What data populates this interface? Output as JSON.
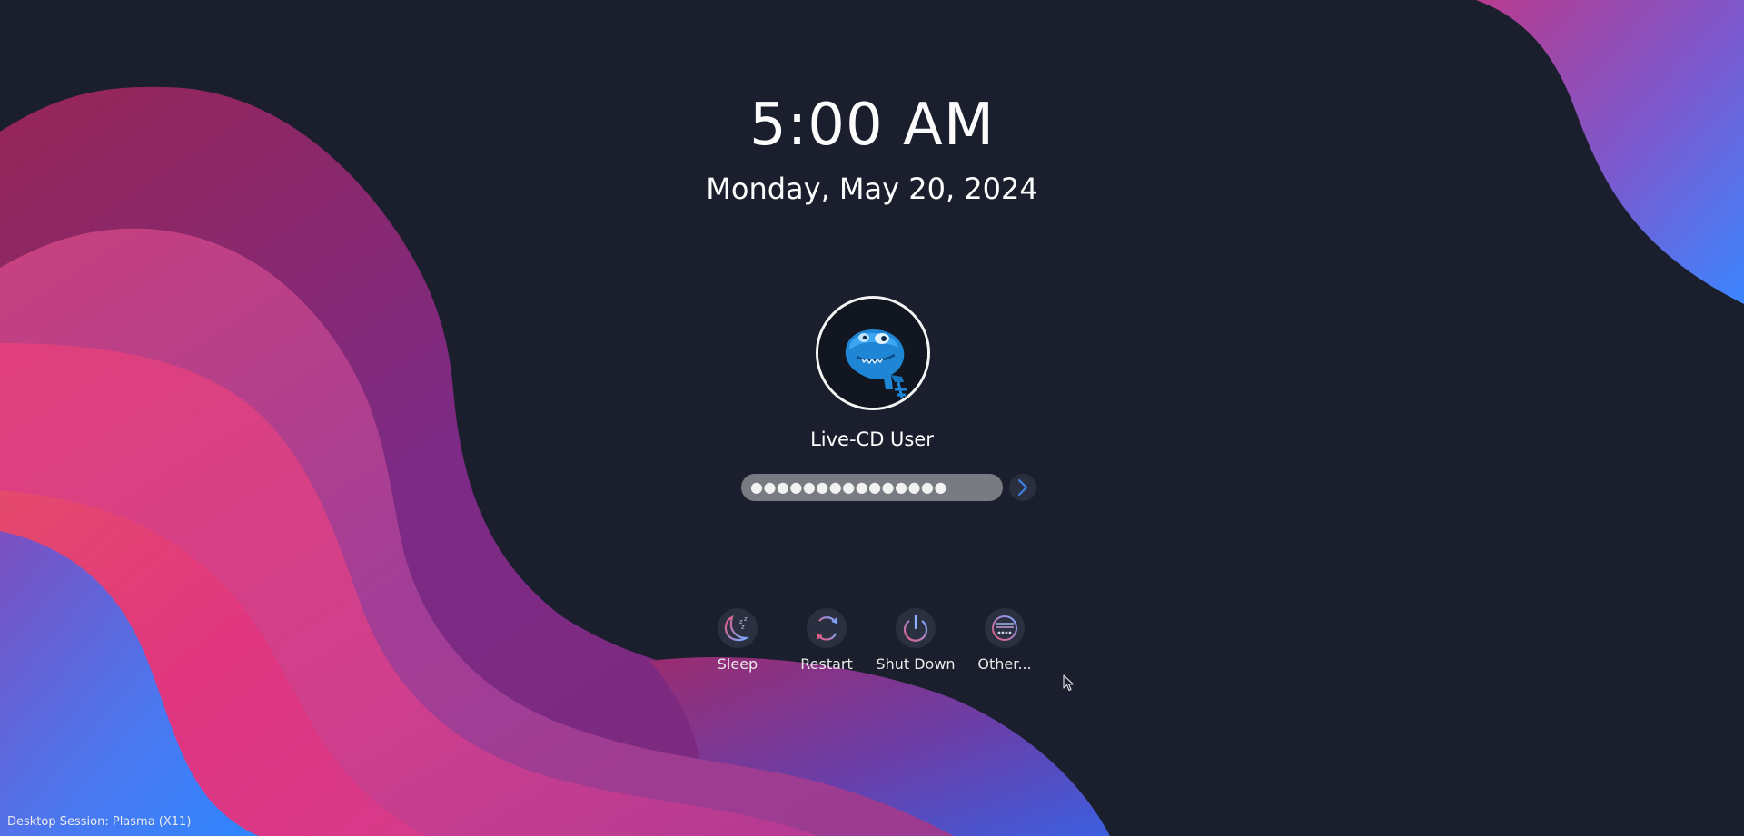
{
  "lock_screen": {
    "time": "5:00 AM",
    "date": "Monday, May 20, 2024"
  },
  "user": {
    "name": "Live-CD User",
    "avatar_icon": "dinosaur-avatar-icon"
  },
  "login": {
    "password_value": "●●●●●●●●●●●●●●●",
    "submit_icon": "chevron-right-icon"
  },
  "actions": [
    {
      "label": "Sleep",
      "icon": "sleep-icon"
    },
    {
      "label": "Restart",
      "icon": "restart-icon"
    },
    {
      "label": "Shut Down",
      "icon": "power-icon"
    },
    {
      "label": "Other...",
      "icon": "other-icon"
    }
  ],
  "footer": {
    "session_label": "Desktop Session: Plasma (X11)"
  },
  "colors": {
    "background": "#1b1f2d",
    "wave_pink": "#d63384",
    "wave_purple": "#8e2a7c",
    "wave_blue": "#3b7dfc",
    "accent": "#3daee9"
  }
}
